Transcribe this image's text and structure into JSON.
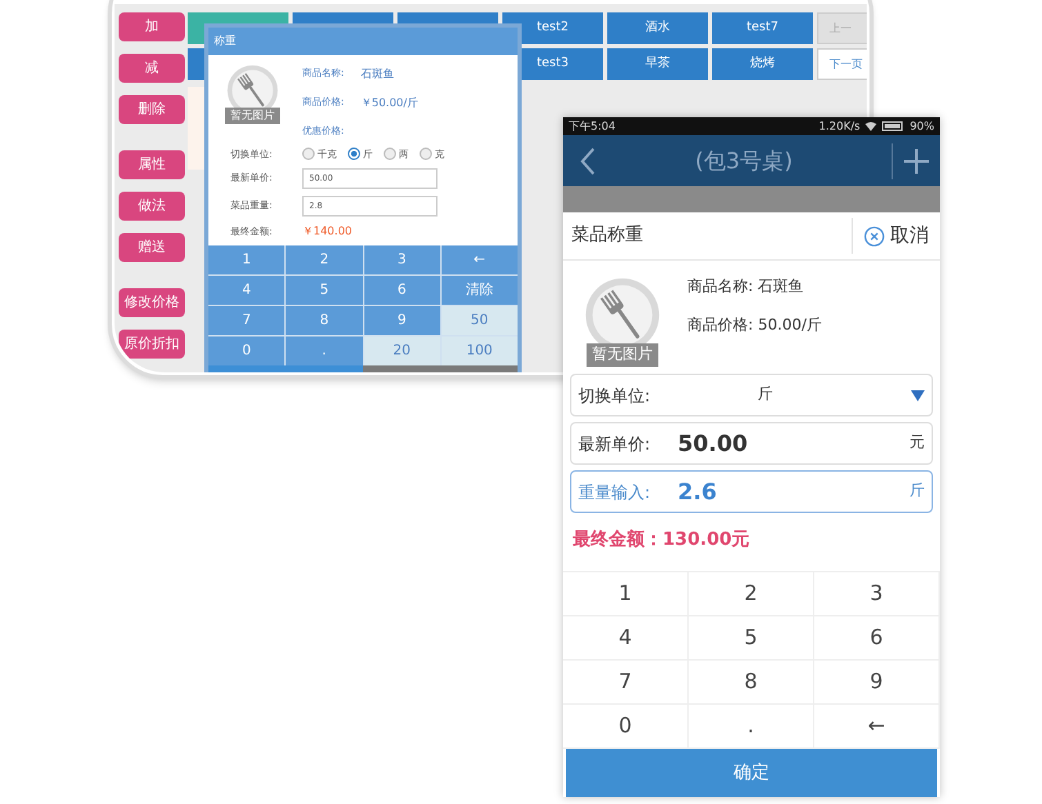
{
  "tablet": {
    "sidebar": [
      "加",
      "减",
      "删除",
      "属性",
      "做法",
      "赠送",
      "修改价格",
      "原价折扣"
    ],
    "dish_rows": [
      [
        {
          "color": "#3bb3a4"
        },
        {
          "color": "#2f7fc8"
        },
        {
          "color": "#2f7fc8"
        },
        {
          "label": "test2",
          "color": "#2f7fc8"
        },
        {
          "label": "酒水",
          "color": "#2f7fc8"
        },
        {
          "label": "test7",
          "color": "#2f7fc8"
        }
      ],
      [
        {
          "color": "#2f7fc8"
        },
        {
          "label": "test3",
          "color": "#2f7fc8"
        },
        {
          "label": "早茶",
          "color": "#2f7fc8"
        },
        {
          "label": "烧烤",
          "color": "#2f7fc8"
        }
      ]
    ],
    "pager": [
      {
        "label": "上一",
        "disabled": true
      },
      {
        "label": "下一页",
        "disabled": false
      }
    ],
    "dialog": {
      "title": "称重",
      "image_caption": "暂无图片",
      "info": [
        {
          "label": "商品名称:",
          "value": "石斑鱼"
        },
        {
          "label": "商品价格:",
          "value": "￥50.00/斤"
        },
        {
          "label": "优惠价格:"
        }
      ],
      "unit_label": "切换单位:",
      "units": [
        {
          "label": "千克",
          "selected": false
        },
        {
          "label": "斤",
          "selected": true
        },
        {
          "label": "两",
          "selected": false
        },
        {
          "label": "克",
          "selected": false
        }
      ],
      "fields": [
        {
          "label": "最新单价:",
          "value": "50.00"
        },
        {
          "label": "菜品重量:",
          "value": "2.8"
        }
      ],
      "total": {
        "label": "最终金额:",
        "value": "￥140.00"
      },
      "keypad": [
        {
          "label": "1",
          "kind": "digit"
        },
        {
          "label": "2",
          "kind": "digit"
        },
        {
          "label": "3",
          "kind": "digit"
        },
        {
          "label": "←",
          "kind": "digit"
        },
        {
          "label": "4",
          "kind": "digit"
        },
        {
          "label": "5",
          "kind": "digit"
        },
        {
          "label": "6",
          "kind": "digit"
        },
        {
          "label": "清除",
          "kind": "digit"
        },
        {
          "label": "7",
          "kind": "digit"
        },
        {
          "label": "8",
          "kind": "digit"
        },
        {
          "label": "9",
          "kind": "digit"
        },
        {
          "label": "50",
          "kind": "preset"
        },
        {
          "label": "0",
          "kind": "digit"
        },
        {
          "label": ".",
          "kind": "digit"
        },
        {
          "label": "20",
          "kind": "preset"
        },
        {
          "label": "100",
          "kind": "preset"
        }
      ],
      "footer_buttons": [
        {
          "color": "#3d8fd6"
        },
        {
          "color": "#7a7a7a"
        }
      ]
    }
  },
  "phone": {
    "status_bar": {
      "time": "下午5:04",
      "speed": "1.20K/s",
      "battery": "90%"
    },
    "header": {
      "title": "(包3号桌)"
    },
    "dialog": {
      "title": "菜品称重",
      "cancel": "取消",
      "image_caption": "暂无图片",
      "info": [
        {
          "label": "商品名称:",
          "value": "石斑鱼"
        },
        {
          "label": "商品价格:",
          "value": "50.00/斤"
        }
      ],
      "unit_select": {
        "label": "切换单位:",
        "value": "斤"
      },
      "fields": [
        {
          "label": "最新单价:",
          "value": "50.00",
          "unit": "元",
          "focused": false
        },
        {
          "label": "重量输入:",
          "value": "2.6",
          "unit": "斤",
          "focused": true
        }
      ],
      "total": "最终金额：130.00元",
      "keypad": [
        "1",
        "2",
        "3",
        "4",
        "5",
        "6",
        "7",
        "8",
        "9",
        "0",
        ".",
        "←"
      ],
      "confirm": "确定"
    }
  }
}
